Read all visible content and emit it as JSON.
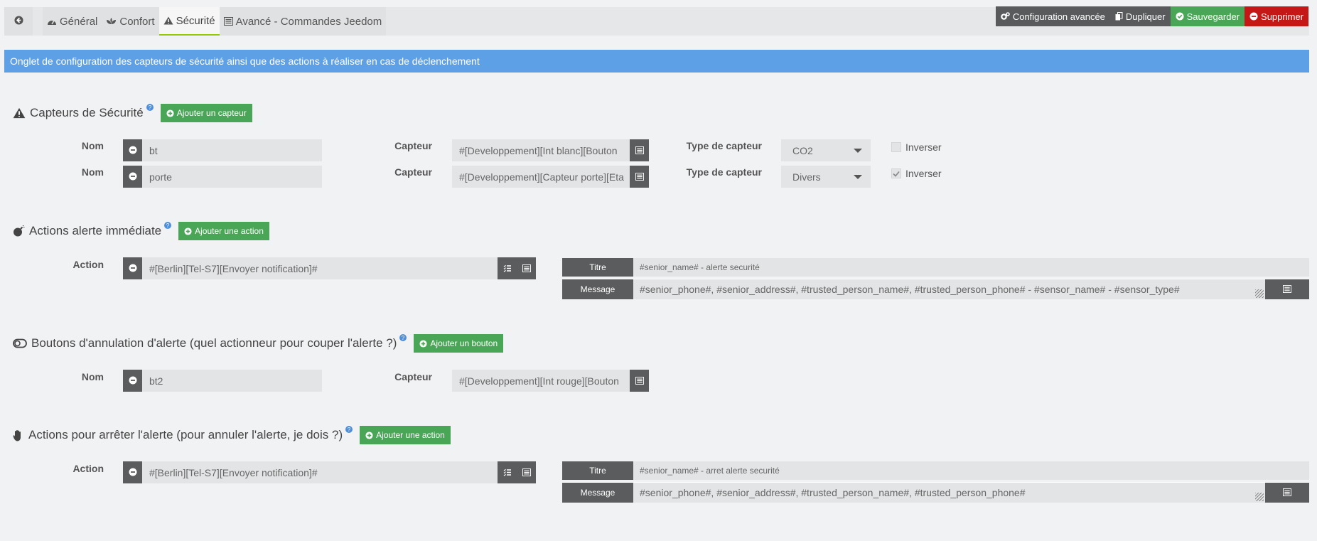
{
  "tabs": {
    "general": "Général",
    "confort": "Confort",
    "securite": "Sécurité",
    "avance": "Avancé - Commandes Jeedom"
  },
  "toolbar": {
    "config": "Configuration avancée",
    "duplicate": "Dupliquer",
    "save": "Sauvegarder",
    "delete": "Supprimer"
  },
  "banner": "Onglet de configuration des capteurs de sécurité ainsi que des actions à réaliser en cas de déclenchement",
  "sensors": {
    "title": "Capteurs de Sécurité",
    "add": "Ajouter un capteur",
    "rows": [
      {
        "nom_label": "Nom",
        "nom": "bt",
        "capteur_label": "Capteur",
        "capteur": "#[Developpement][Int blanc][Bouton",
        "type_label": "Type de capteur",
        "type": "CO2",
        "inverser": "Inverser",
        "checked": false
      },
      {
        "nom_label": "Nom",
        "nom": "porte",
        "capteur_label": "Capteur",
        "capteur": "#[Developpement][Capteur porte][Eta",
        "type_label": "Type de capteur",
        "type": "Divers",
        "inverser": "Inverser",
        "checked": true
      }
    ]
  },
  "immediate": {
    "title": "Actions alerte immédiate",
    "add": "Ajouter une action",
    "action_label": "Action",
    "action": "#[Berlin][Tel-S7][Envoyer notification]#",
    "titre_label": "Titre",
    "titre": "#senior_name# - alerte securité",
    "message_label": "Message",
    "message": "#senior_phone#, #senior_address#, #trusted_person_name#, #trusted_person_phone# - #sensor_name# - #sensor_type#"
  },
  "cancel_buttons": {
    "title": "Boutons d'annulation d'alerte (quel actionneur pour couper l'alerte ?)",
    "add": "Ajouter un bouton",
    "nom_label": "Nom",
    "nom": "bt2",
    "capteur_label": "Capteur",
    "capteur": "#[Developpement][Int rouge][Bouton"
  },
  "stop": {
    "title": "Actions pour arrêter l'alerte (pour annuler l'alerte, je dois ?)",
    "add": "Ajouter une action",
    "action_label": "Action",
    "action": "#[Berlin][Tel-S7][Envoyer notification]#",
    "titre_label": "Titre",
    "titre": "#senior_name# - arret alerte securité",
    "message_label": "Message",
    "message": "#senior_phone#, #senior_address#, #trusted_person_name#, #trusted_person_phone#"
  }
}
